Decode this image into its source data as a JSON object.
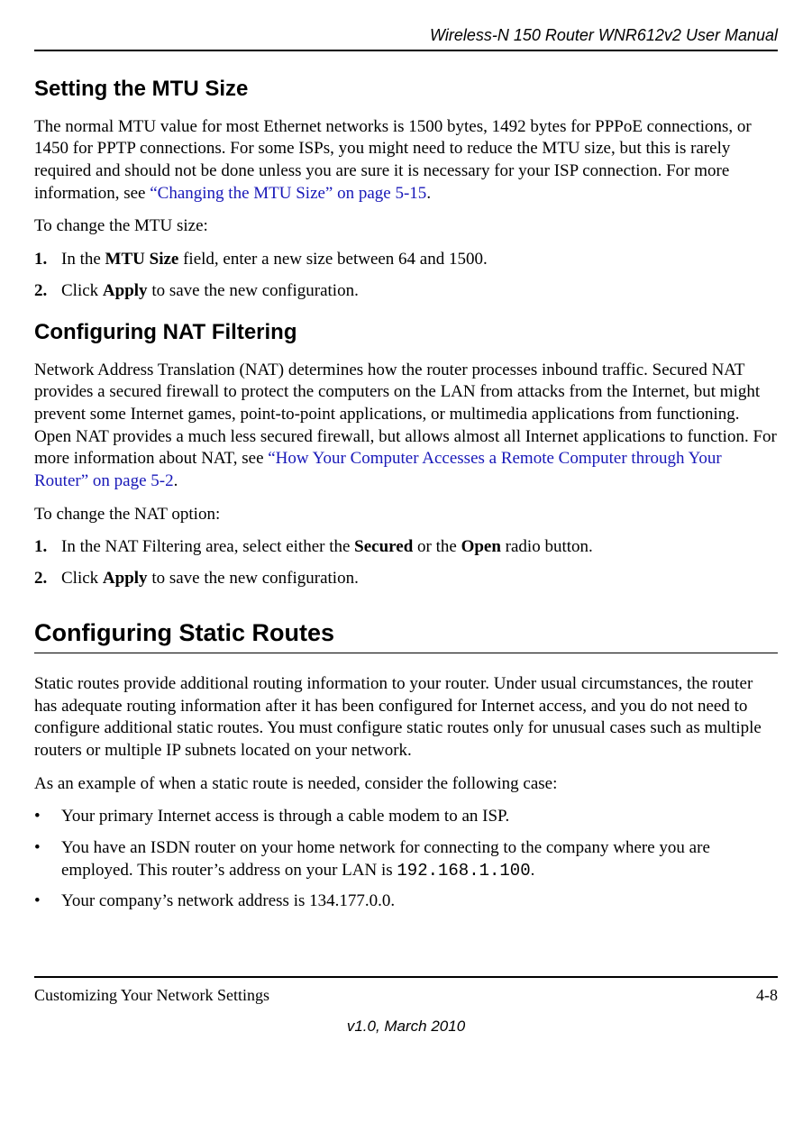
{
  "header": {
    "title": "Wireless-N 150 Router WNR612v2 User Manual"
  },
  "section1": {
    "heading": "Setting the MTU Size",
    "para1_a": "The normal MTU value for most Ethernet networks is 1500 bytes, 1492 bytes for PPPoE connections, or 1450 for PPTP connections. For some ISPs, you might need to reduce the MTU size, but this is rarely required and should not be done unless you are sure it is necessary for your ISP connection. For more information, see ",
    "para1_link": "“Changing the MTU Size” on page 5-15",
    "para1_b": ".",
    "para2": "To change the MTU size:",
    "step1_num": "1.",
    "step1_a": "In the ",
    "step1_bold": "MTU Size",
    "step1_b": " field, enter a new size between 64 and 1500.",
    "step2_num": "2.",
    "step2_a": "Click ",
    "step2_bold": "Apply",
    "step2_b": " to save the new configuration."
  },
  "section2": {
    "heading": "Configuring NAT Filtering",
    "para1_a": "Network Address Translation (NAT) determines how the router processes inbound traffic. Secured NAT provides a secured firewall to protect the computers on the LAN from attacks from the Internet, but might prevent some Internet games, point-to-point applications, or multimedia applications from functioning. Open NAT provides a much less secured firewall, but allows almost all Internet applications to function. For more information about NAT, see ",
    "para1_link": "“How Your Computer Accesses a Remote Computer through Your Router” on page 5-2",
    "para1_b": ".",
    "para2": "To change the NAT option:",
    "step1_num": "1.",
    "step1_a": "In the NAT Filtering area, select either the ",
    "step1_bold1": "Secured",
    "step1_mid": " or the ",
    "step1_bold2": "Open",
    "step1_b": " radio button.",
    "step2_num": "2.",
    "step2_a": "Click ",
    "step2_bold": "Apply",
    "step2_b": " to save the new configuration."
  },
  "section3": {
    "heading": "Configuring Static Routes",
    "para1": "Static routes provide additional routing information to your router. Under usual circumstances, the router has adequate routing information after it has been configured for Internet access, and you do not need to configure additional static routes. You must configure static routes only for unusual cases such as multiple routers or multiple IP subnets located on your network.",
    "para2": "As an example of when a static route is needed, consider the following case:",
    "bullet_dot": "•",
    "bullet1": "Your primary Internet access is through a cable modem to an ISP.",
    "bullet2_a": "You have an ISDN router on your home network for connecting to the company where you are employed. This router’s address on your LAN is ",
    "bullet2_ip": "192.168.1.100",
    "bullet2_b": ".",
    "bullet3": "Your company’s network address is 134.177.0.0."
  },
  "footer": {
    "left": "Customizing Your Network Settings",
    "right": "4-8",
    "center": "v1.0, March 2010"
  }
}
